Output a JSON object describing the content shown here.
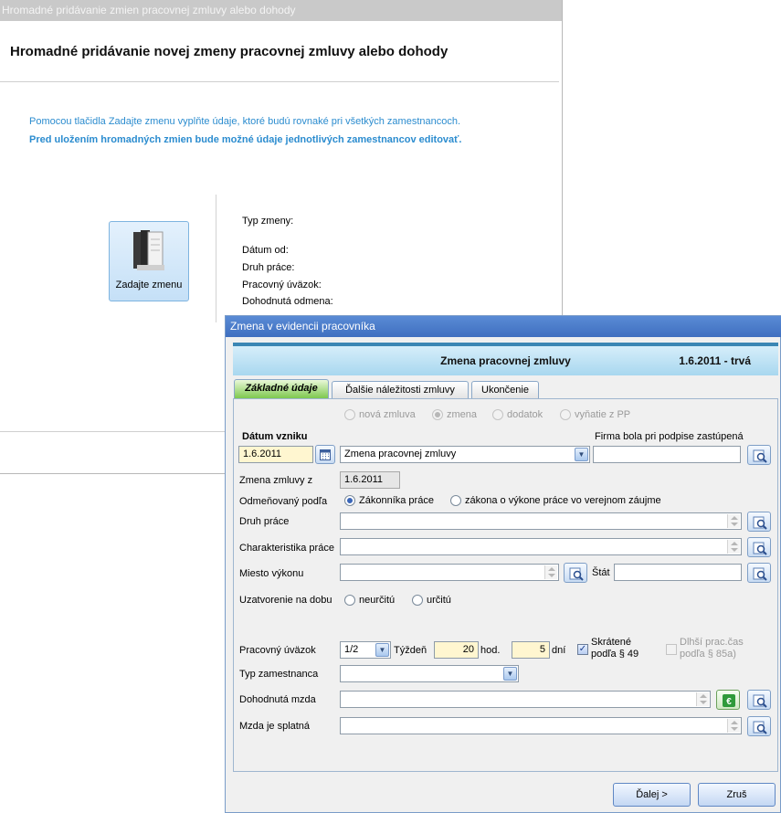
{
  "bg_window": {
    "title": "Hromadné pridávanie zmien pracovnej zmluvy alebo dohody",
    "heading": "Hromadné pridávanie novej zmeny pracovnej zmluvy alebo dohody",
    "info_line1": "Pomocou tlačidla Zadajte zmenu vyplňte údaje, ktoré budú rovnaké pri všetkých zamestnancoch.",
    "info_line2": "Pred uložením hromadných zmien bude možné údaje jednotlivých zamestnancov editovať.",
    "enter_change_button": "Zadajte zmenu",
    "fields": {
      "change_type": "Typ zmeny:",
      "date_from": "Dátum od:",
      "work_type": "Druh práce:",
      "workload": "Pracovný úväzok:",
      "agreed_pay": "Dohodnutá odmena:"
    }
  },
  "dialog": {
    "title": "Zmena v evidencii pracovníka",
    "banner_title": "Zmena pracovnej zmluvy",
    "banner_date": "1.6.2011 - trvá",
    "tabs": [
      {
        "label": "Základné údaje",
        "active": true
      },
      {
        "label": "Ďalšie náležitosti zmluvy",
        "active": false
      },
      {
        "label": "Ukončenie",
        "active": false
      }
    ],
    "contract_type_radios": [
      {
        "label": "nová zmluva",
        "selected": false
      },
      {
        "label": "zmena",
        "selected": true
      },
      {
        "label": "dodatok",
        "selected": false
      },
      {
        "label": "vyňatie z PP",
        "selected": false
      }
    ],
    "date_created_label": "Dátum vzniku",
    "date_created_value": "1.6.2011",
    "contract_select_value": "Zmena pracovnej zmluvy",
    "company_represented_label": "Firma bola pri podpise zastúpená",
    "contract_change_from_label": "Zmena zmluvy z",
    "contract_change_from_value": "1.6.2011",
    "rewarded_by_label": "Odmeňovaný podľa",
    "rewarded_by_options": [
      {
        "label": "Zákonníka práce",
        "selected": true
      },
      {
        "label": "zákona o výkone práce vo verejnom záujme",
        "selected": false
      }
    ],
    "work_type_label": "Druh práce",
    "work_characteristic_label": "Charakteristika práce",
    "place_label": "Miesto výkonu",
    "state_label": "Štát",
    "term_label": "Uzatvorenie na dobu",
    "term_options": [
      {
        "label": "neurčitú",
        "selected": false
      },
      {
        "label": "určitú",
        "selected": false
      }
    ],
    "workload_label": "Pracovný úväzok",
    "workload_value": "1/2",
    "week_label": "Týždeň",
    "hours_value": "20",
    "hours_unit": "hod.",
    "days_value": "5",
    "days_unit": "dní",
    "shortened_label_line1": "Skrátené",
    "shortened_label_line2": "podľa § 49",
    "shortened_checked": true,
    "longer_label_line1": "Dlhší prac.čas",
    "longer_label_line2": "podľa § 85a)",
    "employee_type_label": "Typ zamestnanca",
    "agreed_wage_label": "Dohodnutá mzda",
    "wage_payable_label": "Mzda je splatná",
    "next_button": "Ďalej >",
    "cancel_button": "Zruš"
  }
}
